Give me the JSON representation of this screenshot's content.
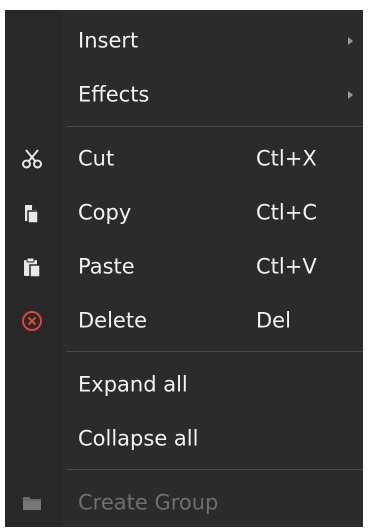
{
  "menu": {
    "items": [
      {
        "label": "Insert",
        "icon": "",
        "shortcut": "",
        "submenu": true
      },
      {
        "label": "Effects",
        "icon": "",
        "shortcut": "",
        "submenu": true
      },
      {
        "label": "Cut",
        "icon": "scissors-icon",
        "shortcut": "Ctl+X"
      },
      {
        "label": "Copy",
        "icon": "copy-icon",
        "shortcut": "Ctl+C"
      },
      {
        "label": "Paste",
        "icon": "paste-icon",
        "shortcut": "Ctl+V"
      },
      {
        "label": "Delete",
        "icon": "delete-icon",
        "shortcut": "Del"
      },
      {
        "label": "Expand all",
        "icon": "",
        "shortcut": ""
      },
      {
        "label": "Collapse all",
        "icon": "",
        "shortcut": ""
      },
      {
        "label": "Create Group",
        "icon": "folder-icon",
        "shortcut": "",
        "disabled": true
      }
    ]
  },
  "colors": {
    "background": "#2b2b2b",
    "text": "#f3f3f3",
    "disabled_text": "#6f6f6f",
    "delete_icon": "#e0463a",
    "separator": "#4a4a4a"
  }
}
